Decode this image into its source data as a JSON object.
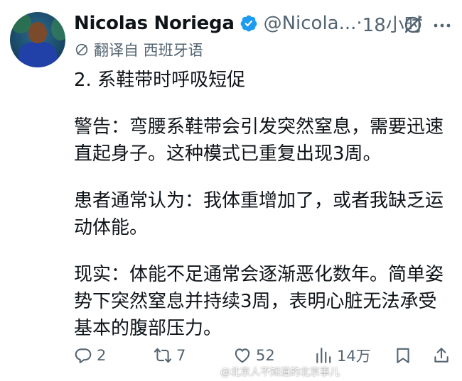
{
  "tweet": {
    "author_name": "Nicolas Noriega",
    "handle": "@Nicola...",
    "separator": " · ",
    "time": "18小时",
    "translated_label": "翻译自 西班牙语",
    "paragraphs": [
      "2. 系鞋带时呼吸短促",
      "警告：弯腰系鞋带会引发突然窒息，需要迅速直起身子。这种模式已重复出现3周。",
      "患者通常认为：我体重增加了，或者我缺乏运动体能。",
      "现实：体能不足通常会逐渐恶化数年。简单姿势下突然窒息并持续3周，表明心脏无法承受基本的腹部压力。"
    ],
    "replies": "2",
    "reposts": "7",
    "likes": "52",
    "views": "14万"
  },
  "watermark": "@北京人不知道的北京事儿",
  "colors": {
    "text": "#0f1419",
    "secondary": "#536471",
    "verified": "#1d9bf0"
  },
  "icons": [
    "verified-badge-icon",
    "grok-icon",
    "more-icon",
    "translate-icon",
    "reply-icon",
    "repost-icon",
    "like-icon",
    "views-icon",
    "bookmark-icon",
    "share-icon"
  ]
}
